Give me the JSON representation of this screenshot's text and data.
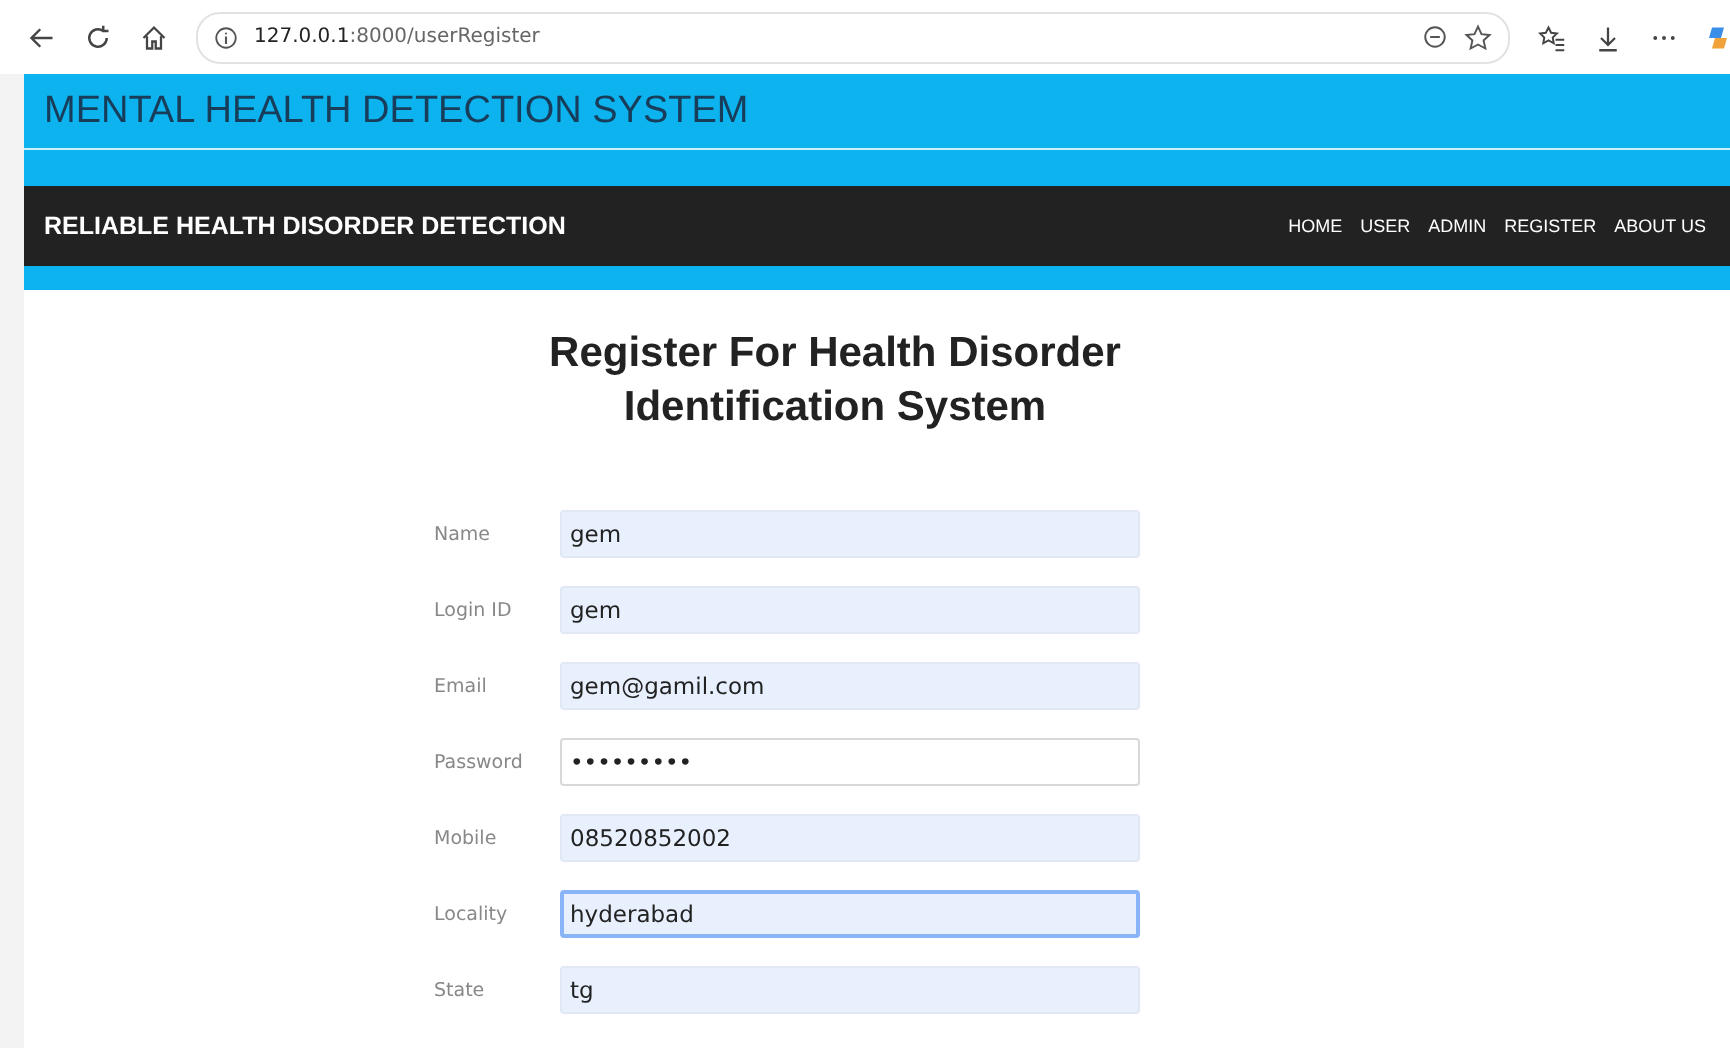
{
  "browser": {
    "url_host": "127.0.0.1",
    "url_rest": ":8000/userRegister"
  },
  "header": {
    "title": "MENTAL HEALTH DETECTION SYSTEM"
  },
  "navbar": {
    "brand": "RELIABLE HEALTH DISORDER DETECTION",
    "links": [
      "HOME",
      "USER",
      "ADMIN",
      "REGISTER",
      "ABOUT US"
    ]
  },
  "form": {
    "heading_lines": [
      "Register For Health Disorder",
      "Identification System"
    ],
    "fields": [
      {
        "label": "Name",
        "value": "gem",
        "autofilled": true,
        "focused": false
      },
      {
        "label": "Login ID",
        "value": "gem",
        "autofilled": true,
        "focused": false
      },
      {
        "label": "Email",
        "value": "gem@gamil.com",
        "autofilled": true,
        "focused": false
      },
      {
        "label": "Password",
        "value": "•••••••••",
        "autofilled": false,
        "focused": false
      },
      {
        "label": "Mobile",
        "value": "08520852002",
        "autofilled": true,
        "focused": false
      },
      {
        "label": "Locality",
        "value": "hyderabad",
        "autofilled": true,
        "focused": true
      },
      {
        "label": "State",
        "value": "tg",
        "autofilled": true,
        "focused": false
      }
    ]
  }
}
